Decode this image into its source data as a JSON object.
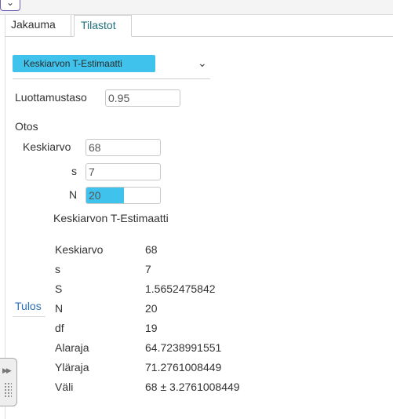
{
  "tabs": [
    {
      "label": "Jakauma",
      "active": false
    },
    {
      "label": "Tilastot",
      "active": true
    }
  ],
  "procedure": {
    "selected": "Keskiarvon T-Estimaatti",
    "icon": "chevron-down-icon",
    "highlight_color": "#3fc3ec"
  },
  "confidence": {
    "label": "Luottamustaso",
    "value": "0.95"
  },
  "sample": {
    "heading": "Otos",
    "mean_label": "Keskiarvo",
    "mean_value": "68",
    "s_label": "s",
    "s_value": "7",
    "n_label": "N",
    "n_value": "20"
  },
  "result": {
    "title": "Keskiarvon T-Estimaatti",
    "side_label": "Tulos",
    "rows": [
      {
        "key": "Keskiarvo",
        "value": "68"
      },
      {
        "key": "s",
        "value": "7"
      },
      {
        "key": "S",
        "value": "1.5652475842"
      },
      {
        "key": "N",
        "value": "20"
      },
      {
        "key": "df",
        "value": "19"
      },
      {
        "key": "Alaraja",
        "value": "64.7238991551"
      },
      {
        "key": "Yläraja",
        "value": "71.2761008449"
      },
      {
        "key": "Väli",
        "value": "68 ± 3.2761008449"
      }
    ]
  },
  "colors": {
    "tab_active": "#1f6f7a",
    "link": "#2a6fb5"
  }
}
